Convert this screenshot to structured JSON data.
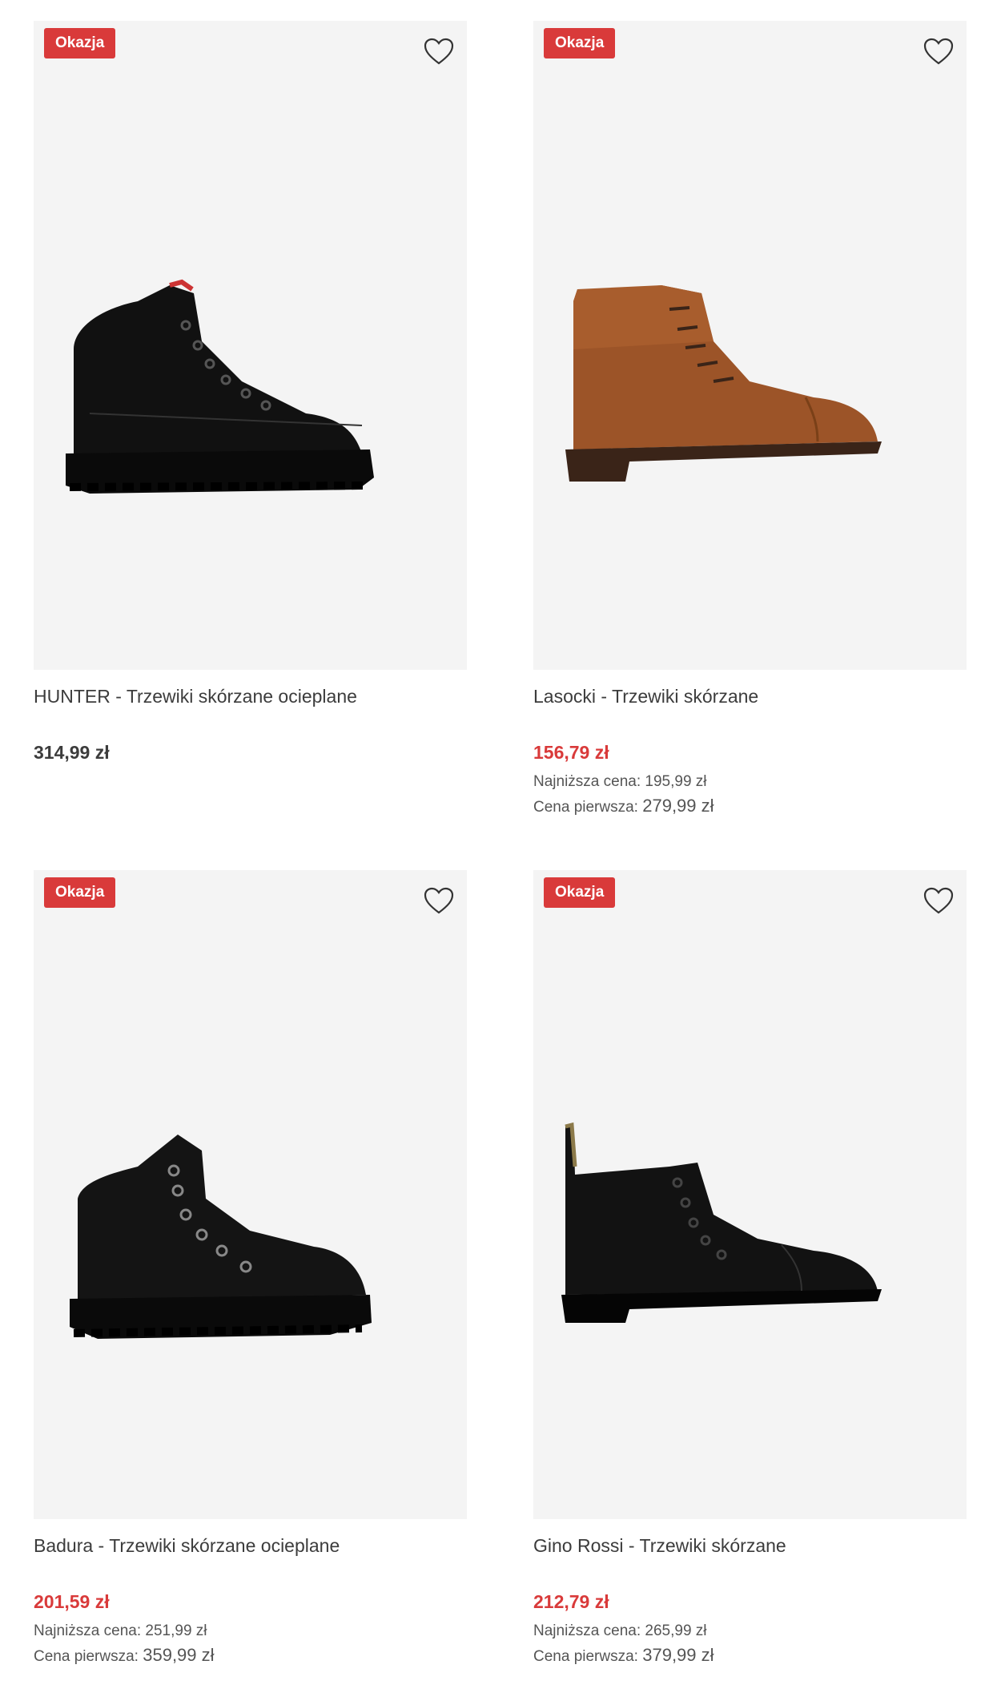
{
  "colors": {
    "sale": "#d93a3a",
    "image_bg": "#f4f4f4",
    "text": "#3c3c3c"
  },
  "products": [
    {
      "badge": "Okazja",
      "title": "HUNTER - Trzewiki skórzane ocieplane",
      "price": "314,99 zł",
      "on_sale": false,
      "shoe_color": "black",
      "icon": "heart-icon"
    },
    {
      "badge": "Okazja",
      "title": "Lasocki - Trzewiki skórzane",
      "price": "156,79 zł",
      "on_sale": true,
      "lowest_label": "Najniższa cena:",
      "lowest_value": "195,99 zł",
      "first_label": "Cena pierwsza:",
      "first_value": "279,99 zł",
      "shoe_color": "brown",
      "icon": "heart-icon"
    },
    {
      "badge": "Okazja",
      "title": "Badura - Trzewiki skórzane ocieplane",
      "price": "201,59 zł",
      "on_sale": true,
      "lowest_label": "Najniższa cena:",
      "lowest_value": "251,99 zł",
      "first_label": "Cena pierwsza:",
      "first_value": "359,99 zł",
      "shoe_color": "black",
      "icon": "heart-icon"
    },
    {
      "badge": "Okazja",
      "title": "Gino Rossi - Trzewiki skórzane",
      "price": "212,79 zł",
      "on_sale": true,
      "lowest_label": "Najniższa cena:",
      "lowest_value": "265,99 zł",
      "first_label": "Cena pierwsza:",
      "first_value": "379,99 zł",
      "shoe_color": "black",
      "icon": "heart-icon"
    }
  ]
}
